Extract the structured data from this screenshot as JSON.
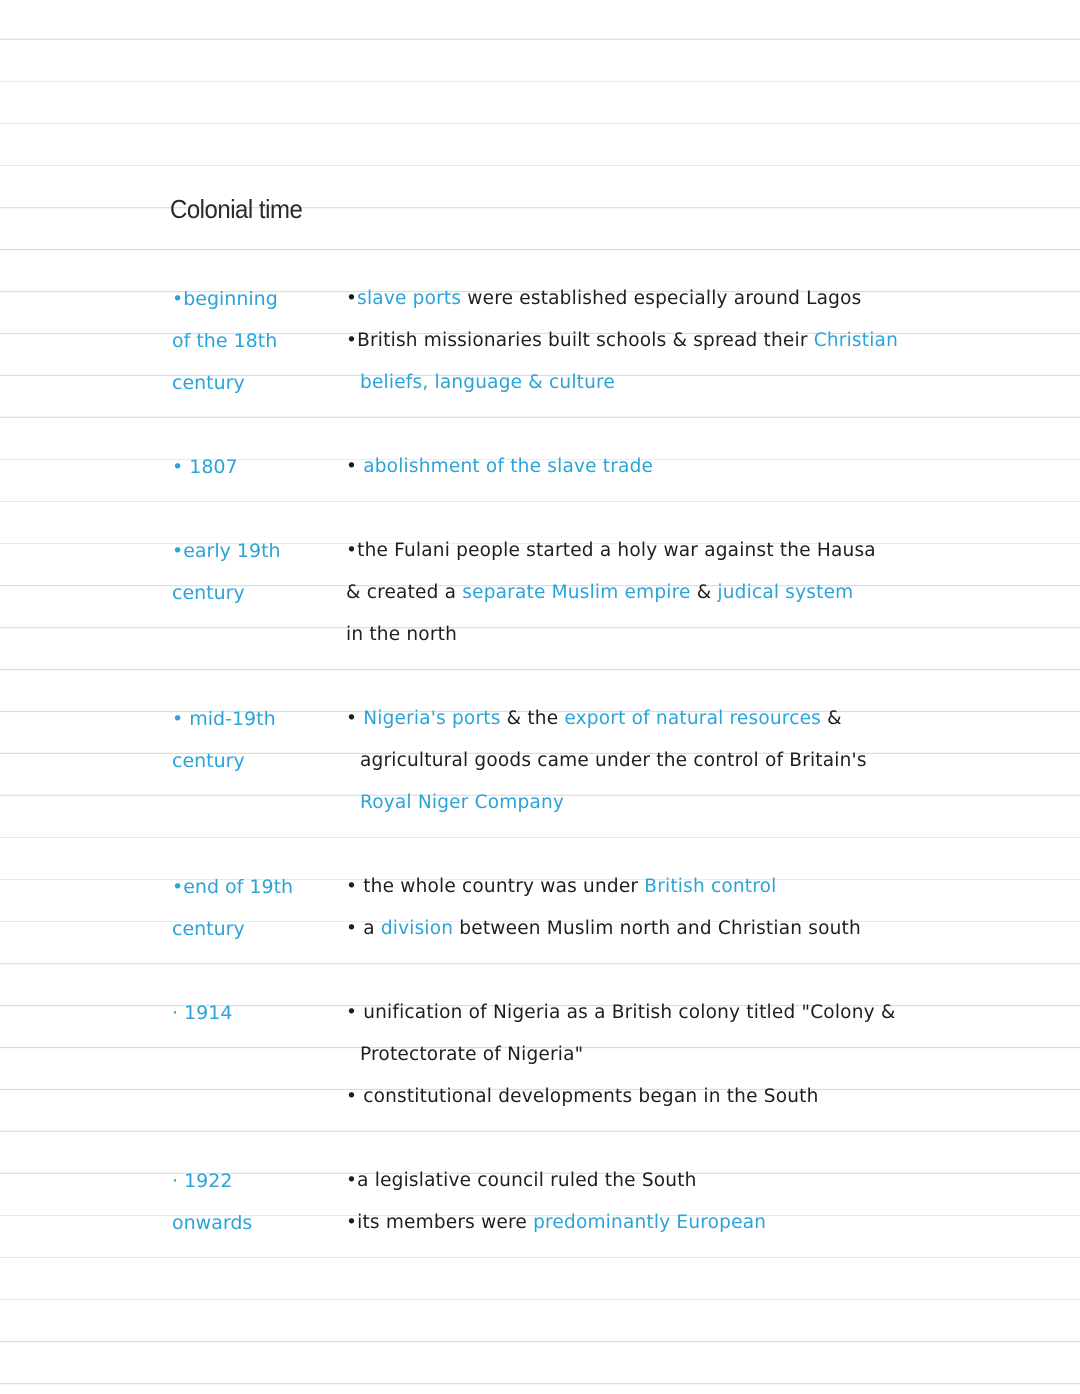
{
  "title": "Colonial time",
  "accent_color": "#2aa3d8",
  "entries": [
    {
      "date": "•beginning\nof the 18th\ncentury",
      "lines": [
        [
          {
            "t": "•"
          },
          {
            "t": "slave ports",
            "hl": true
          },
          {
            "t": " were established especially around Lagos"
          }
        ],
        [
          {
            "t": "•British missionaries built schools & spread their "
          },
          {
            "t": "Christian",
            "hl": true
          }
        ],
        [
          {
            "t": "beliefs, language & culture",
            "hl": true,
            "indent": true
          }
        ]
      ]
    },
    {
      "date": "• 1807",
      "lines": [
        [
          {
            "t": "• "
          },
          {
            "t": "abolishment of the slave trade",
            "hl": true
          }
        ]
      ]
    },
    {
      "date": "•early 19th\ncentury",
      "lines": [
        [
          {
            "t": "•the Fulani people started a holy war against the Hausa"
          }
        ],
        [
          {
            "t": "& created a "
          },
          {
            "t": "separate Muslim empire",
            "hl": true
          },
          {
            "t": " & "
          },
          {
            "t": "judical system",
            "hl": true
          }
        ],
        [
          {
            "t": "in the north"
          }
        ]
      ]
    },
    {
      "date": "• mid-19th\ncentury",
      "lines": [
        [
          {
            "t": "• "
          },
          {
            "t": "Nigeria's ports",
            "hl": true
          },
          {
            "t": " & the "
          },
          {
            "t": "export of natural resources",
            "hl": true
          },
          {
            "t": " &"
          }
        ],
        [
          {
            "t": "agricultural goods came under the control of Britain's",
            "indent": true
          }
        ],
        [
          {
            "t": "Royal Niger Company",
            "hl": true,
            "indent": true
          }
        ]
      ]
    },
    {
      "date": "•end of 19th\ncentury",
      "lines": [
        [
          {
            "t": "• the whole country was under "
          },
          {
            "t": "British control",
            "hl": true
          }
        ],
        [
          {
            "t": "• a "
          },
          {
            "t": "division",
            "hl": true
          },
          {
            "t": " between Muslim north and Christian south"
          }
        ]
      ]
    },
    {
      "date": "· 1914",
      "lines": [
        [
          {
            "t": "• unification of Nigeria as a British colony titled \"Colony &"
          }
        ],
        [
          {
            "t": "Protectorate of Nigeria\"",
            "indent": true
          }
        ],
        [
          {
            "t": "• constitutional developments began in the South"
          }
        ]
      ]
    },
    {
      "date": "· 1922\nonwards",
      "lines": [
        [
          {
            "t": "•a legislative council ruled the South"
          }
        ],
        [
          {
            "t": "•its members were "
          },
          {
            "t": "predominantly European",
            "hl": true
          }
        ]
      ]
    }
  ]
}
